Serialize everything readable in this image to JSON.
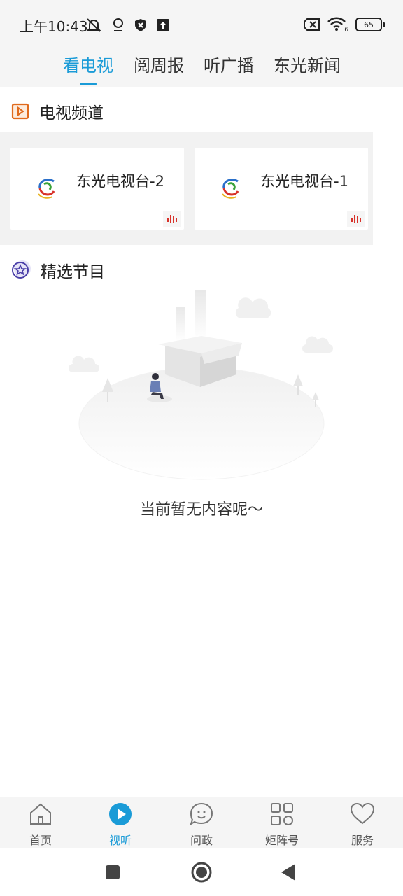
{
  "status_bar": {
    "time": "上午10:43",
    "battery_level": "65",
    "left_icons": [
      "notifications-muted-icon",
      "location-icon",
      "shield-icon",
      "upload-icon"
    ],
    "right_icons": [
      "sim-disabled-icon",
      "wifi-icon",
      "battery-icon"
    ],
    "wifi_label": "6"
  },
  "top_tabs": {
    "items": [
      {
        "label": "看电视",
        "active": true
      },
      {
        "label": "阅周报",
        "active": false
      },
      {
        "label": "听广播",
        "active": false
      },
      {
        "label": "东光新闻",
        "active": false
      }
    ],
    "accent_color": "#1a9bd7"
  },
  "tv_section": {
    "title": "电视频道",
    "icon": "tv-play-icon",
    "channels": [
      {
        "name": "东光电视台-2",
        "logo": "station-logo-icon",
        "live_icon": "audio-wave-icon"
      },
      {
        "name": "东光电视台-1",
        "logo": "station-logo-icon",
        "live_icon": "audio-wave-icon"
      }
    ]
  },
  "featured_section": {
    "title": "精选节目",
    "icon": "star-badge-icon",
    "empty_text": "当前暂无内容呢～"
  },
  "bottom_nav": {
    "items": [
      {
        "label": "首页",
        "icon": "home-icon",
        "active": false
      },
      {
        "label": "视听",
        "icon": "play-circle-icon",
        "active": true
      },
      {
        "label": "问政",
        "icon": "chat-bubble-icon",
        "active": false
      },
      {
        "label": "矩阵号",
        "icon": "grid-icon",
        "active": false
      },
      {
        "label": "服务",
        "icon": "heart-icon",
        "active": false
      }
    ]
  },
  "system_nav": {
    "buttons": [
      "recent-apps-icon",
      "home-circle-icon",
      "back-icon"
    ]
  }
}
